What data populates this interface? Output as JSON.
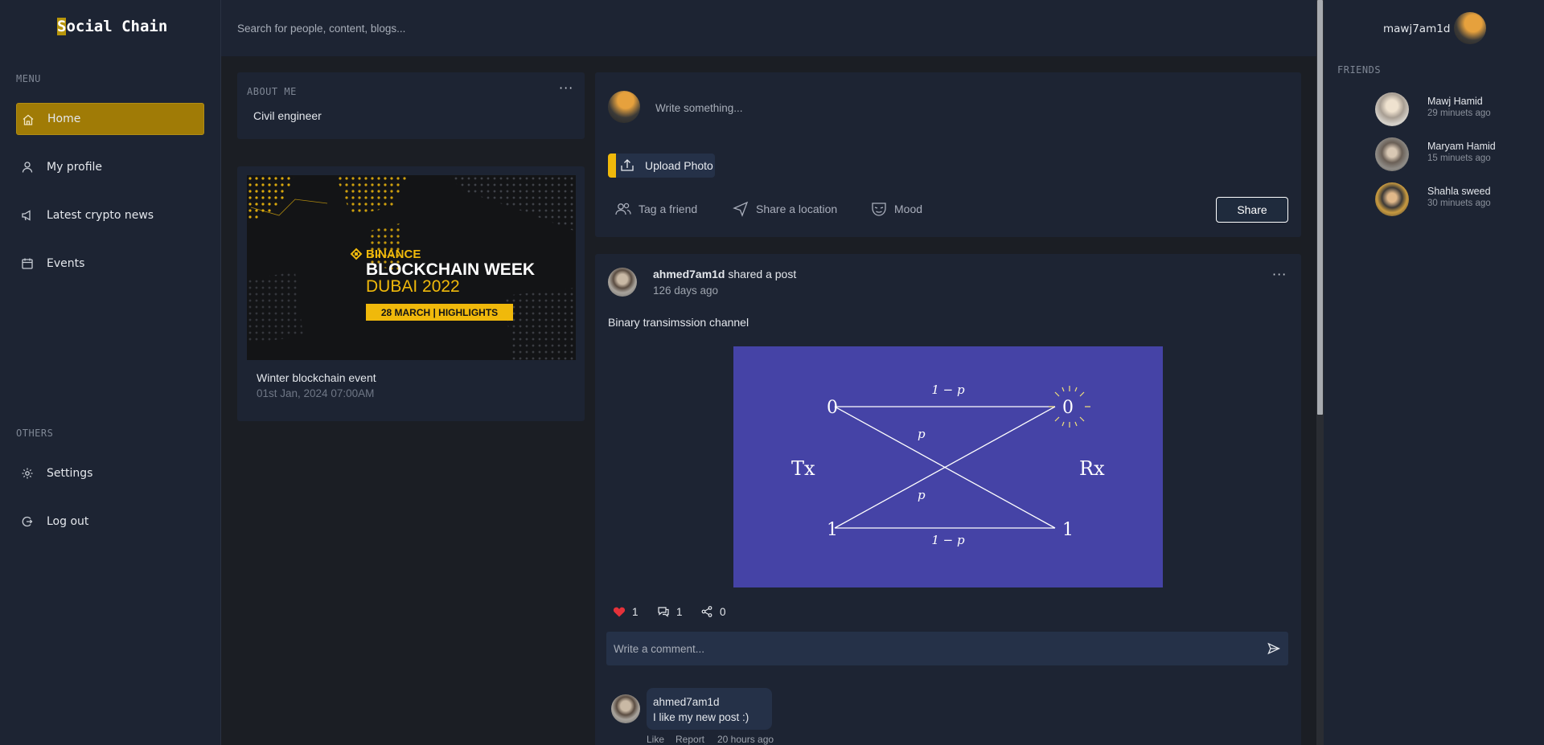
{
  "app": {
    "logo": "Social Chain",
    "logo_first": "S",
    "logo_rest": "ocial Chain"
  },
  "search": {
    "placeholder": "Search for people, content, blogs..."
  },
  "sidebar": {
    "menu_label": "MENU",
    "items": [
      {
        "label": "Home",
        "icon": "home-icon",
        "active": true
      },
      {
        "label": "My profile",
        "icon": "user-icon"
      },
      {
        "label": "Latest crypto news",
        "icon": "megaphone-icon"
      },
      {
        "label": "Events",
        "icon": "calendar-icon"
      }
    ],
    "others_label": "OTHERS",
    "others": [
      {
        "label": "Settings",
        "icon": "gear-icon"
      },
      {
        "label": "Log out",
        "icon": "logout-icon"
      }
    ]
  },
  "about": {
    "title": "ABOUT ME",
    "value": "Civil engineer",
    "menu": "···"
  },
  "event": {
    "banner": {
      "brand": "BINANCE",
      "line1": "BLOCKCHAIN WEEK",
      "line2": "DUBAI 2022",
      "tag": "28 MARCH  |  HIGHLIGHTS"
    },
    "name": "Winter blockchain event",
    "date": "01st Jan, 2024 07:00AM"
  },
  "composer": {
    "placeholder": "Write something...",
    "upload_label": "Upload Photo",
    "actions": [
      {
        "label": "Tag a friend",
        "icon": "people-icon"
      },
      {
        "label": "Share a location",
        "icon": "location-arrow-icon"
      },
      {
        "label": "Mood",
        "icon": "mask-icon"
      }
    ],
    "share_label": "Share"
  },
  "post": {
    "author": "ahmed7am1d",
    "action": "shared a post",
    "time": "126 days ago",
    "menu": "···",
    "text": "Binary transimssion channel",
    "image": {
      "tx": "Tx",
      "rx": "Rx",
      "top_left": "0",
      "top_right": "0",
      "bottom_left": "1",
      "bottom_right": "1",
      "top_edge": "1 − p",
      "bottom_edge": "1 − p",
      "cross_top": "p",
      "cross_bottom": "p",
      "bg_color": "#4543a6"
    },
    "likes": "1",
    "comments": "1",
    "shares": "0",
    "comment_placeholder": "Write a comment...",
    "comment": {
      "author": "ahmed7am1d",
      "text": "I like my new post :)",
      "like": "Like",
      "report": "Report",
      "time": "20 hours ago"
    }
  },
  "user": {
    "name": "mawj7am1d"
  },
  "friends": {
    "label": "FRIENDS",
    "list": [
      {
        "name": "Mawj Hamid",
        "time": "29 minuets ago"
      },
      {
        "name": "Maryam Hamid",
        "time": "15 minuets ago"
      },
      {
        "name": "Shahla sweed",
        "time": "30 minuets ago"
      }
    ]
  },
  "colors": {
    "accent": "#f0b90b",
    "active_nav": "#a07b06",
    "panel": "#1d2433",
    "bg": "#1b1e24",
    "heart": "#e5323a"
  }
}
